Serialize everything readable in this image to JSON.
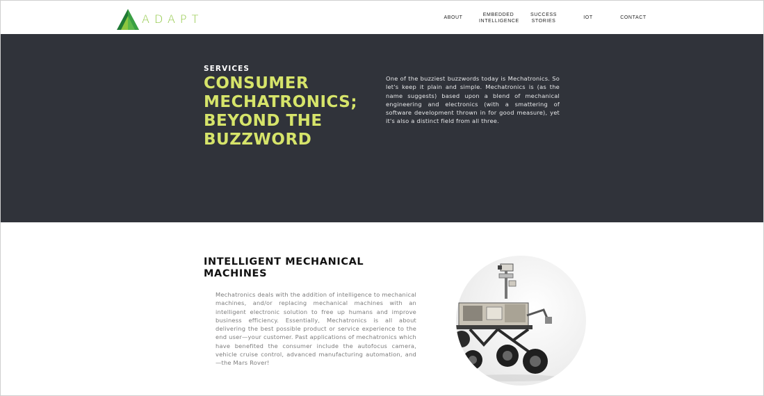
{
  "header": {
    "logo_text": "ADAPT",
    "nav": [
      {
        "label": "ABOUT"
      },
      {
        "label_line1": "EMBEDDED",
        "label_line2": "INTELLIGENCE"
      },
      {
        "label_line1": "SUCCESS",
        "label_line2": "STORIES"
      },
      {
        "label": "IOT"
      },
      {
        "label": "CONTACT"
      }
    ]
  },
  "hero": {
    "eyebrow": "SERVICES",
    "title_lines": [
      "CONSUMER",
      "MECHATRONICS;",
      "BEYOND THE",
      "BUZZWORD"
    ],
    "body": "One of the buzziest buzzwords today is Mechatronics. So let's keep it plain and simple. Mechatronics is (as the name suggests) based upon a blend of mechanical engineering and electronics (with a smattering of software development thrown in for good measure), yet it's also a distinct field from all three."
  },
  "section2": {
    "title_lines": [
      "INTELLIGENT MECHANICAL",
      "MACHINES"
    ],
    "body": "Mechatronics deals with the addition of intelligence to mechanical machines, and/or replacing mechanical machines with an intelligent electronic solution to free up humans and improve business efficiency. Essentially, Mechatronics is all about delivering the best possible product or service experience to the end user—your customer. Past applications of mechatronics which have benefited the consumer include the autofocus camera, vehicle cruise control, advanced manufacturing automation, and—the Mars Rover!",
    "image_icon": "mars-rover-image"
  },
  "colors": {
    "hero_bg": "#30333a",
    "accent_yellow": "#d6e46a",
    "logo_green": "#8cc63f"
  }
}
